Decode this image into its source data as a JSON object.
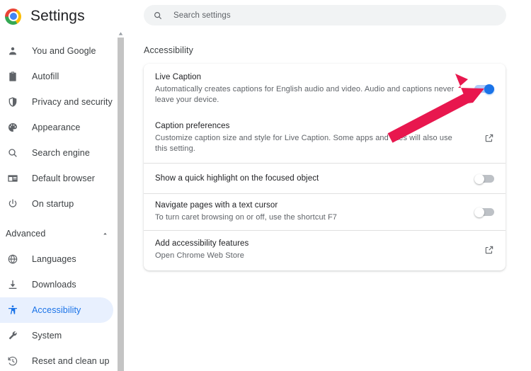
{
  "app": {
    "title": "Settings",
    "logo_icon": "chrome-logo"
  },
  "search": {
    "placeholder": "Search settings",
    "value": "",
    "icon": "search-icon"
  },
  "sidebar": {
    "items": [
      {
        "label": "You and Google",
        "icon": "person-icon",
        "active": false
      },
      {
        "label": "Autofill",
        "icon": "clipboard-icon",
        "active": false
      },
      {
        "label": "Privacy and security",
        "icon": "shield-icon",
        "active": false
      },
      {
        "label": "Appearance",
        "icon": "palette-icon",
        "active": false
      },
      {
        "label": "Search engine",
        "icon": "magnifier-icon",
        "active": false
      },
      {
        "label": "Default browser",
        "icon": "browser-window-icon",
        "active": false
      },
      {
        "label": "On startup",
        "icon": "power-icon",
        "active": false
      }
    ],
    "advanced": {
      "label": "Advanced",
      "chevron_icon": "chevron-up-icon",
      "expanded": true,
      "items": [
        {
          "label": "Languages",
          "icon": "globe-icon",
          "active": false
        },
        {
          "label": "Downloads",
          "icon": "download-icon",
          "active": false
        },
        {
          "label": "Accessibility",
          "icon": "accessibility-person-icon",
          "active": true
        },
        {
          "label": "System",
          "icon": "wrench-icon",
          "active": false
        },
        {
          "label": "Reset and clean up",
          "icon": "history-restore-icon",
          "active": false
        }
      ]
    },
    "scrollbar": {
      "up_arrow_icon": "scroll-up-arrow-icon"
    }
  },
  "main": {
    "section_title": "Accessibility",
    "rows": [
      {
        "title": "Live Caption",
        "subtitle": "Automatically creates captions for English audio and video. Audio and captions never leave your device.",
        "control": "toggle",
        "toggle_state": "on"
      },
      {
        "title": "Caption preferences",
        "subtitle": "Customize caption size and style for Live Caption. Some apps and sites will also use this setting.",
        "control": "external-link",
        "icon": "open-in-new-icon"
      },
      {
        "title": "Show a quick highlight on the focused object",
        "subtitle": "",
        "control": "toggle",
        "toggle_state": "off"
      },
      {
        "title": "Navigate pages with a text cursor",
        "subtitle": "To turn caret browsing on or off, use the shortcut F7",
        "control": "toggle",
        "toggle_state": "off"
      },
      {
        "title": "Add accessibility features",
        "subtitle": "Open Chrome Web Store",
        "control": "external-link",
        "icon": "open-in-new-icon"
      }
    ]
  },
  "annotation": {
    "type": "arrow",
    "color": "#e8174e",
    "points_to": "live-caption-toggle"
  },
  "colors": {
    "accent_blue": "#1a73e8",
    "active_pill_bg": "#e8f0fe",
    "toggle_on_track": "#aecbfa",
    "toggle_off_track": "#bdc1c6",
    "text_primary": "#202124",
    "text_secondary": "#5f6368",
    "search_bg": "#f1f3f4",
    "annotation_red": "#e8174e"
  }
}
